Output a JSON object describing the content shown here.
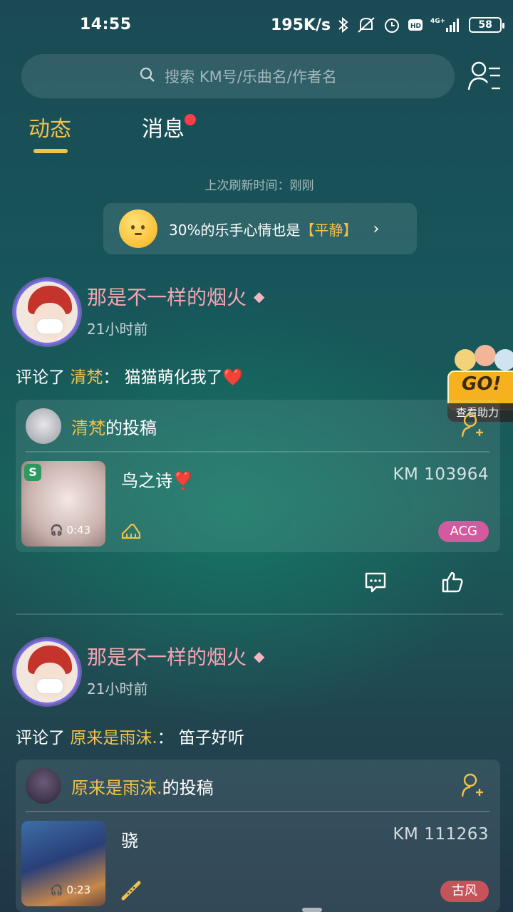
{
  "status_bar": {
    "time": "14:55",
    "speed": "195K/s",
    "network": "4G+",
    "battery": "58"
  },
  "search": {
    "placeholder": "搜索 KM号/乐曲名/作者名"
  },
  "tabs": [
    {
      "label": "动态",
      "active": true
    },
    {
      "label": "消息",
      "active": false,
      "has_dot": true
    }
  ],
  "refresh_text": "上次刷新时间：刚刚",
  "mood_banner": {
    "prefix": "30%的乐手心情也是",
    "highlight": "【平静】"
  },
  "floating_badge": {
    "title": "GO!",
    "subtitle": "查看助力",
    "icon": "cartoon-heads-icon"
  },
  "posts": [
    {
      "author": "那是不一样的烟火",
      "badge_icon": "diamond-icon",
      "time": "21小时前",
      "comment_prefix": "评论了",
      "comment_target": "清梵",
      "comment_text": "：  猫猫萌化我了",
      "comment_emoji": "❤️",
      "card": {
        "uploader": "清梵",
        "suffix": " 的投稿",
        "song_title": "鸟之诗",
        "song_emoji": "❣️",
        "km_id": "KM 103964",
        "duration": "0:43",
        "instrument_icon": "piano-icon",
        "tag": "ACG",
        "tag_color": "#d45aa0"
      }
    },
    {
      "author": "那是不一样的烟火",
      "badge_icon": "diamond-icon",
      "time": "21小时前",
      "comment_prefix": "评论了",
      "comment_target": "原来是雨沫.",
      "comment_text": "：  笛子好听",
      "card": {
        "uploader": "原来是雨沫.",
        "suffix": " 的投稿",
        "song_title": "骁",
        "km_id": "KM 111263",
        "duration": "0:23",
        "instrument_icon": "flute-icon",
        "tag": "古风",
        "tag_color": "#c8525a"
      }
    }
  ]
}
